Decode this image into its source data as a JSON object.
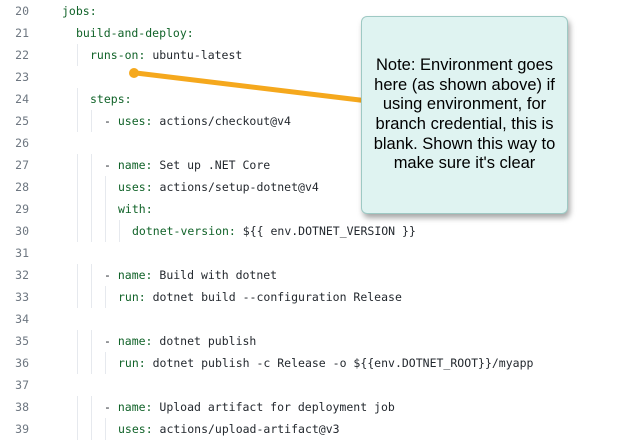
{
  "code": {
    "lines": [
      {
        "num": "20",
        "indent": 0,
        "key": "jobs:",
        "value": ""
      },
      {
        "num": "21",
        "indent": 1,
        "key": "build-and-deploy:",
        "value": ""
      },
      {
        "num": "22",
        "indent": 2,
        "key": "runs-on:",
        "value": " ubuntu-latest"
      },
      {
        "num": "23",
        "indent": 0,
        "key": "",
        "value": ""
      },
      {
        "num": "24",
        "indent": 2,
        "key": "steps:",
        "value": ""
      },
      {
        "num": "25",
        "indent": 3,
        "key": "- uses:",
        "value": " actions/checkout@v4"
      },
      {
        "num": "26",
        "indent": 0,
        "key": "",
        "value": ""
      },
      {
        "num": "27",
        "indent": 3,
        "key": "- name:",
        "value": " Set up .NET Core"
      },
      {
        "num": "28",
        "indent": 4,
        "key": "uses:",
        "value": " actions/setup-dotnet@v4"
      },
      {
        "num": "29",
        "indent": 4,
        "key": "with:",
        "value": ""
      },
      {
        "num": "30",
        "indent": 5,
        "key": "dotnet-version:",
        "value": " ${{ env.DOTNET_VERSION }}"
      },
      {
        "num": "31",
        "indent": 0,
        "key": "",
        "value": ""
      },
      {
        "num": "32",
        "indent": 3,
        "key": "- name:",
        "value": " Build with dotnet"
      },
      {
        "num": "33",
        "indent": 4,
        "key": "run:",
        "value": " dotnet build --configuration Release"
      },
      {
        "num": "34",
        "indent": 0,
        "key": "",
        "value": ""
      },
      {
        "num": "35",
        "indent": 3,
        "key": "- name:",
        "value": " dotnet publish"
      },
      {
        "num": "36",
        "indent": 4,
        "key": "run:",
        "value": " dotnet publish -c Release -o ${{env.DOTNET_ROOT}}/myapp"
      },
      {
        "num": "37",
        "indent": 0,
        "key": "",
        "value": ""
      },
      {
        "num": "38",
        "indent": 3,
        "key": "- name:",
        "value": " Upload artifact for deployment job"
      },
      {
        "num": "39",
        "indent": 4,
        "key": "uses:",
        "value": " actions/upload-artifact@v3"
      }
    ]
  },
  "annotation": {
    "text": "Note: Environment goes here (as shown above) if using environment, for branch credential, this is blank. Shown this way to make sure it's clear"
  },
  "colors": {
    "arrow": "#f5a81d",
    "callout_bg": "#dff3f1",
    "yaml_key": "#116329",
    "line_number": "#6e7781"
  }
}
